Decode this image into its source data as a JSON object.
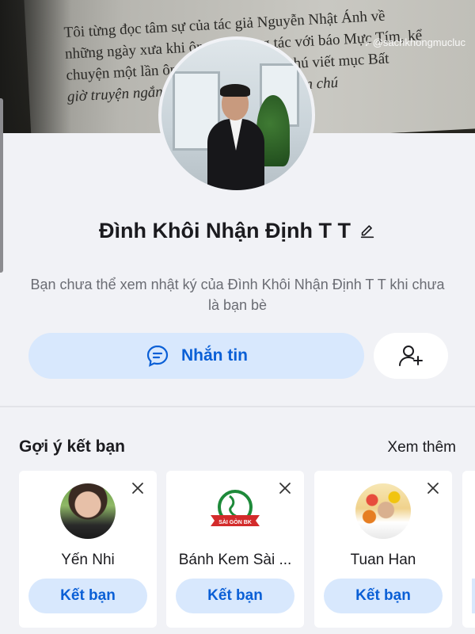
{
  "cover": {
    "text_lines": [
      "Tôi từng đọc tâm sự của tác giả Nguyễn Nhật Ánh về",
      "những ngày xưa khi ông còn cộng tác với báo Mực Tím, kể",
      "chuyện một lần ông nhờ các chú chị chú viết mục Bất",
      "giờ truyện ngắn khi đọc một truyện ngắn chú"
    ],
    "watermark": "@sachkhongmucluc"
  },
  "profile": {
    "name": "Đình Khôi Nhận Định T T",
    "notice": "Bạn chưa thể xem nhật ký của Đình Khôi Nhận Định T T khi chưa là bạn bè"
  },
  "actions": {
    "message_label": "Nhắn tin"
  },
  "suggestions": {
    "title": "Gợi ý kết bạn",
    "see_more": "Xem thêm",
    "cards": [
      {
        "name": "Yến Nhi",
        "button": "Kết bạn"
      },
      {
        "name": "Bánh Kem Sài ...",
        "button": "Kết bạn",
        "logo_text": "SÀI GÒN BK"
      },
      {
        "name": "Tuan Han",
        "button": "Kết bạn"
      }
    ]
  },
  "colors": {
    "accent": "#0a5fd6",
    "button_bg": "#d8e8fd",
    "page_bg": "#f1f2f6"
  },
  "icons": [
    "pencil-icon",
    "chat-icon",
    "add-friend-icon",
    "close-icon",
    "tiktok-icon"
  ]
}
